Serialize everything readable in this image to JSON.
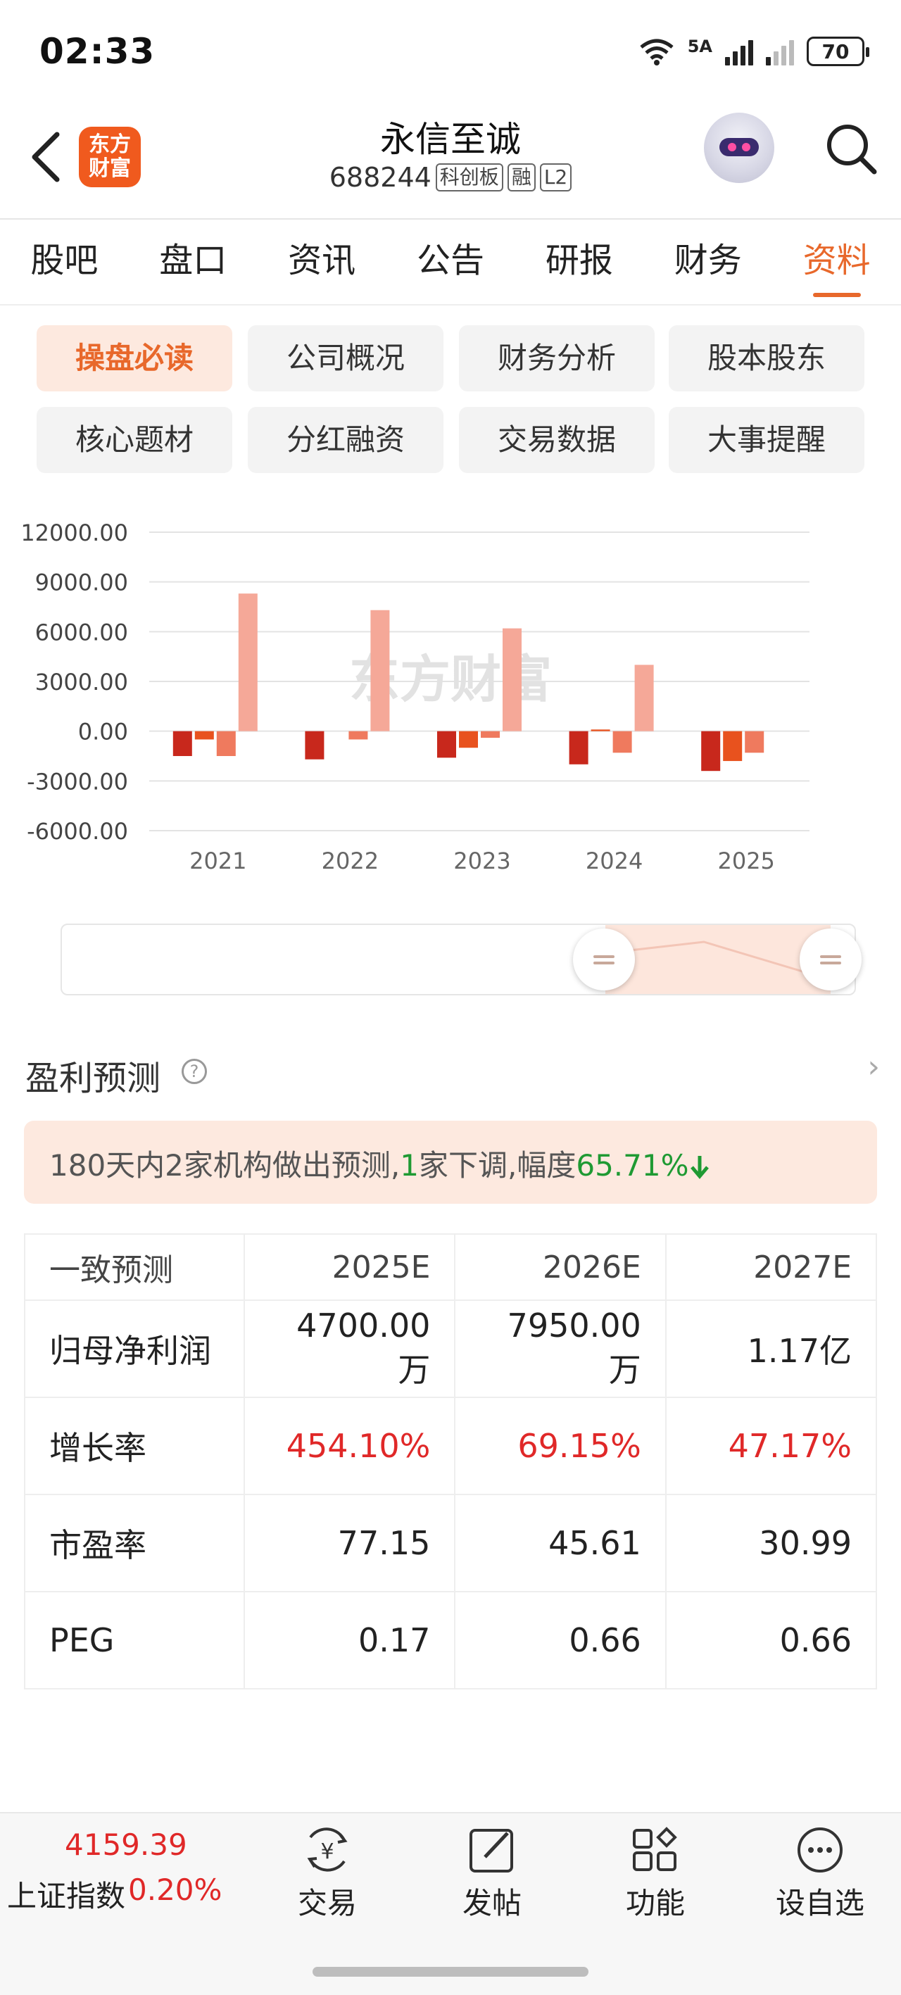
{
  "status_bar": {
    "time": "02:33",
    "network": "5A",
    "battery": "70"
  },
  "header": {
    "logo_line1": "东方",
    "logo_line2": "财富",
    "stock_name": "永信至诚",
    "stock_code": "688244",
    "tags": [
      "科创板",
      "融",
      "L2"
    ]
  },
  "tabs": [
    "股吧",
    "盘口",
    "资讯",
    "公告",
    "研报",
    "财务",
    "资料"
  ],
  "active_tab": "资料",
  "sub_tabs": [
    "操盘必读",
    "公司概况",
    "财务分析",
    "股本股东",
    "核心题材",
    "分红融资",
    "交易数据",
    "大事提醒"
  ],
  "active_sub_tab": "操盘必读",
  "chart_data": {
    "type": "bar",
    "watermark": "东方财富",
    "categories": [
      "2021",
      "2022",
      "2023",
      "2024",
      "2025"
    ],
    "ylim": [
      -6000,
      12000
    ],
    "y_ticks": [
      "12000.00",
      "9000.00",
      "6000.00",
      "3000.00",
      "0.00",
      "-3000.00",
      "-6000.00"
    ],
    "series": [
      {
        "values": [
          -1500,
          -1700,
          -1600,
          -2000,
          -2400
        ],
        "color": "#c8281c"
      },
      {
        "values": [
          -500,
          null,
          -1000,
          100,
          -1800
        ],
        "color": "#e8521e"
      },
      {
        "values": [
          -1500,
          -500,
          -400,
          -1300,
          -1300
        ],
        "color": "#ef7a5e"
      },
      {
        "values": [
          8300,
          7300,
          6200,
          4000,
          null
        ],
        "color": "#f5a898"
      }
    ]
  },
  "forecast": {
    "title": "盈利预测",
    "banner_prefix": "180天内2家机构做出预测,",
    "banner_down_count": "1",
    "banner_mid": "家下调,幅度",
    "banner_pct": "65.71%",
    "table": {
      "header": [
        "一致预测",
        "2025E",
        "2026E",
        "2027E"
      ],
      "rows": [
        {
          "label": "归母净利润",
          "values": [
            "4700.00万",
            "7950.00万",
            "1.17亿"
          ]
        },
        {
          "label": "增长率",
          "values": [
            "454.10%",
            "69.15%",
            "47.17%"
          ]
        },
        {
          "label": "市盈率",
          "values": [
            "77.15",
            "45.61",
            "30.99"
          ]
        },
        {
          "label": "PEG",
          "values": [
            "0.17",
            "0.66",
            "0.66"
          ]
        }
      ]
    }
  },
  "bottom_bar": {
    "index_value": "4159.39",
    "index_name": "上证指数",
    "index_change": "0.20%",
    "items": [
      "交易",
      "发帖",
      "功能",
      "设自选"
    ]
  }
}
